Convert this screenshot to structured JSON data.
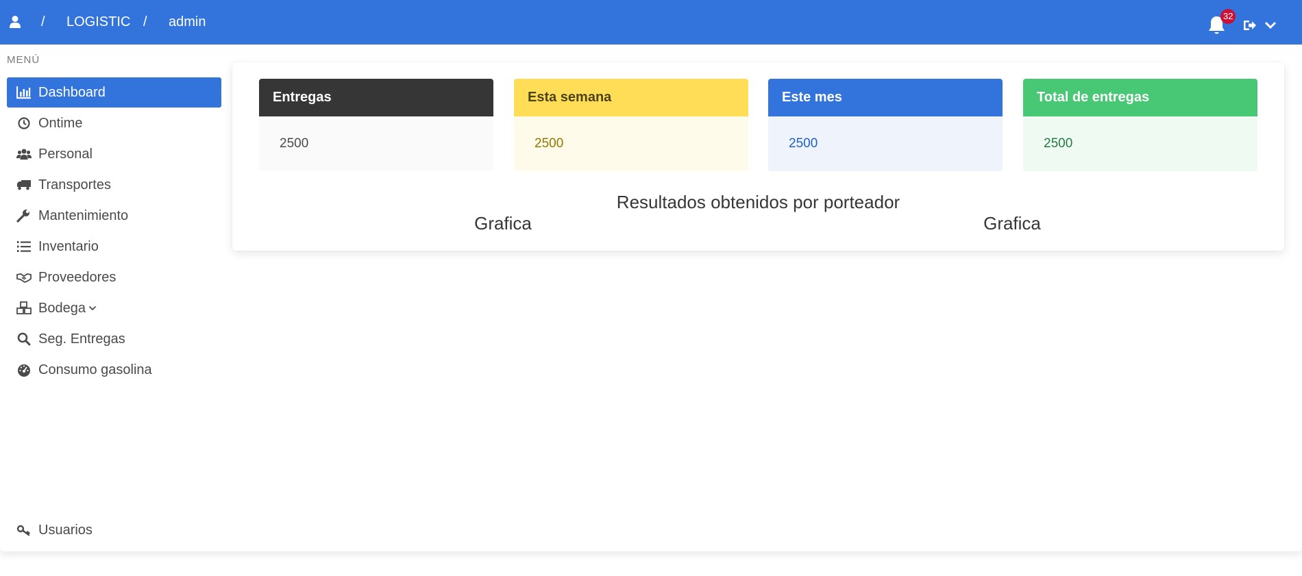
{
  "header": {
    "breadcrumb": [
      {
        "label": "/"
      },
      {
        "label": "LOGISTIC"
      },
      {
        "label": "/"
      },
      {
        "label": "admin"
      }
    ],
    "notification_count": "32",
    "brand_color": "#3273dc"
  },
  "sidebar": {
    "label": "MENÚ",
    "items": [
      {
        "label": "Dashboard",
        "icon": "bar-chart-icon",
        "active": true
      },
      {
        "label": "Ontime",
        "icon": "clock-icon"
      },
      {
        "label": "Personal",
        "icon": "users-icon"
      },
      {
        "label": "Transportes",
        "icon": "truck-icon"
      },
      {
        "label": "Mantenimiento",
        "icon": "wrench-icon"
      },
      {
        "label": "Inventario",
        "icon": "list-ol-icon"
      },
      {
        "label": "Proveedores",
        "icon": "handshake-icon"
      },
      {
        "label": "Bodega",
        "icon": "boxes-icon"
      },
      {
        "label": "Seg. Entregas",
        "icon": "search-icon"
      },
      {
        "label": "Consumo gasolina",
        "icon": "tachometer-icon"
      },
      {
        "label": "Usuarios",
        "icon": "key-icon"
      }
    ]
  },
  "stats": [
    {
      "title": "Entregas",
      "value": "2500",
      "color": "#363636"
    },
    {
      "title": "Esta semana",
      "value": "2500",
      "color": "#ffdd57"
    },
    {
      "title": "Este mes",
      "value": "2500",
      "color": "#3273dc"
    },
    {
      "title": "Total de entregas",
      "value": "2500",
      "color": "#48c774"
    }
  ],
  "results": {
    "title": "Resultados obtenidos por porteador",
    "chart_left_title": "Grafica",
    "chart_right_title": "Grafica"
  }
}
